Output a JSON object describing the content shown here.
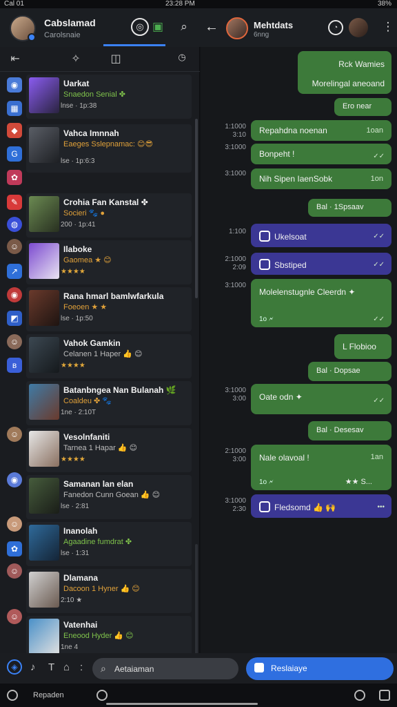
{
  "status": {
    "left": "Cal 01",
    "center": "23:28 PM",
    "right": "38%"
  },
  "header": {
    "name": "Cabslamad",
    "subtitle": "Carolsnaie",
    "chat_name": "Mehtdats",
    "chat_subtitle": "6nng"
  },
  "contacts": [
    {
      "name": "Uarkat",
      "status": "Snaedon Senial ✤",
      "meta": "lnse · 1p:38",
      "accent": "#8a5cf0"
    },
    {
      "name": "Vahca Imnnah",
      "status": "Eaeges Sslepnamac: 😊😎",
      "meta": "lse · 1p:6:3",
      "accent": "#5a5e66"
    },
    {
      "name": "Crohia Fan Kanstal ✤",
      "status": "Socieri 🐾 ●",
      "meta": "200 · 1p:41",
      "accent": "#6b8a52"
    },
    {
      "name": "Ilaboke",
      "status": "Gaomea ★ 😊",
      "meta": "★★★★",
      "accent": "#7c4bd0"
    },
    {
      "name": "Rana hmarl bamlwfarkula",
      "status": "Foeoen ★ ★",
      "meta": "lse · 1p:50",
      "accent": "#6a3a2c"
    },
    {
      "name": "Vahok Gamkin",
      "status": "Celanen 1 Haper 👍 😊",
      "meta": "★★★★",
      "accent": "#3c4852"
    },
    {
      "name": "Batanbngea Nan Bulanah 🌿",
      "status": "Coaldeu ✤ 🐾",
      "meta": "1ne · 2:10T",
      "accent": "#3f7ba6"
    },
    {
      "name": "Vesolnfaniti",
      "status": "Tarnea 1 Hapar 👍 😊",
      "meta": "★★★★",
      "accent": "#bfbfbf"
    },
    {
      "name": "Samanan lan elan",
      "status": "Fanedon Cunn Goean 👍 😊",
      "meta": "lse · 2:81",
      "accent": "#465c3c"
    },
    {
      "name": "Inanolah",
      "status": "Agaadine fumdrat ✤",
      "meta": "lse · 1:31",
      "accent": "#2f6a9a"
    },
    {
      "name": "Dlamana",
      "status": "Dacoon 1 Hyner 👍 😊",
      "meta": "2:10 ★",
      "accent": "#9a9a9a"
    },
    {
      "name": "Vatenhai",
      "status": "Eneood Hyder 👍 😊",
      "meta": "1ne 4",
      "accent": "#4a90c8"
    }
  ],
  "messages": [
    {
      "text": "Rck Wamies",
      "sub": "Morelingal aneoand",
      "side": "right",
      "color": "green"
    },
    {
      "text": "Ero near",
      "side": "right",
      "color": "green"
    },
    {
      "time": "1:1000\n3:10",
      "text": "Repahdna noenan",
      "rt": "1oan",
      "color": "green"
    },
    {
      "time": "3:1000",
      "text": "Bonpeht !",
      "color": "green"
    },
    {
      "time": "3:1000",
      "text": "Nih Sipen IaenSobk",
      "rt": "1on",
      "color": "green"
    },
    {
      "text": "Bal · 1Spsaav",
      "color": "green"
    },
    {
      "time": "1:100",
      "text": "Ukelsoat",
      "color": "purple"
    },
    {
      "time": "2:1000\n2:09",
      "text": "Sbstiped",
      "color": "purple"
    },
    {
      "time": "3:1000",
      "text": "Molelenstugnle Cleerdn ✦",
      "sub": "1o 🗲",
      "color": "green"
    },
    {
      "text": "L Flobioo",
      "color": "green"
    },
    {
      "text": "Bal · Dopsae",
      "color": "green"
    },
    {
      "time": "3:1000\n3:00",
      "text": "Oate odn ✦",
      "color": "green"
    },
    {
      "text": "Bal · Desesav",
      "color": "green"
    },
    {
      "time": "2:1000\n3:00",
      "text": "Nale olavoal !",
      "rt": "1an",
      "sub": "1o 🗲",
      "sub2": "★★ S...",
      "color": "green"
    },
    {
      "time": "3:1000\n2:30",
      "text": "Fledsomd 👍 🙌",
      "color": "purple"
    }
  ],
  "bottom": {
    "search_placeholder": "Aetaiaman",
    "action_label": "Reslaiaye"
  },
  "nav": {
    "label": "Repaden"
  }
}
